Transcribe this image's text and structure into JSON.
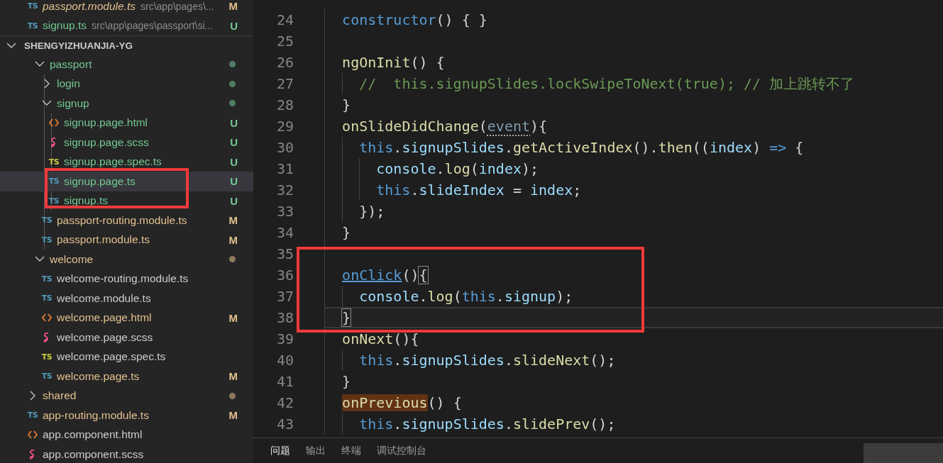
{
  "open_editors": [
    {
      "name": "passport.module.ts",
      "path": "src\\app\\pages\\...",
      "kind": "ts",
      "glyph": "TS",
      "color": "#e2c08d",
      "badge": "M",
      "preview": true
    },
    {
      "name": "signup.ts",
      "path": "src\\app\\pages\\passport\\si...",
      "kind": "ts",
      "glyph": "TS",
      "color": "#73c991",
      "badge": "U",
      "preview": false
    }
  ],
  "explorer": {
    "title": "SHENGYIZHUANJIA-YG",
    "expanded": true,
    "items": [
      {
        "children": [
          {
            "label": "passport",
            "kind": "folder",
            "expanded": true,
            "color": "#73c991",
            "selected": false,
            "children": [
              {
                "label": "login",
                "kind": "folder",
                "expanded": false,
                "color": "#73c991",
                "selected": false
              },
              {
                "label": "signup",
                "kind": "folder",
                "expanded": true,
                "color": "#73c991",
                "selected": false,
                "children": [
                  {
                    "label": "signup.page.html",
                    "kind": "html",
                    "color": "#73c991",
                    "badge": "U",
                    "selected": false
                  },
                  {
                    "label": "signup.page.scss",
                    "kind": "scss",
                    "color": "#73c991",
                    "badge": "U",
                    "selected": false
                  },
                  {
                    "label": "signup.page.spec.ts",
                    "kind": "spec",
                    "glyph": "TS",
                    "color": "#73c991",
                    "badge": "U",
                    "selected": false
                  },
                  {
                    "label": "signup.page.ts",
                    "kind": "ts",
                    "glyph": "TS",
                    "color": "#73c991",
                    "badge": "U",
                    "selected": true
                  },
                  {
                    "label": "signup.ts",
                    "kind": "ts",
                    "glyph": "TS",
                    "color": "#73c991",
                    "badge": "U",
                    "selected": false
                  }
                ]
              },
              {
                "label": "passport-routing.module.ts",
                "kind": "ts",
                "glyph": "TS",
                "color": "#e2c08d",
                "badge": "M",
                "selected": false
              },
              {
                "label": "passport.module.ts",
                "kind": "ts",
                "glyph": "TS",
                "color": "#e2c08d",
                "badge": "M",
                "selected": false
              }
            ]
          },
          {
            "label": "welcome",
            "kind": "folder",
            "expanded": true,
            "color": "#e2c08d",
            "selected": false,
            "children": [
              {
                "label": "welcome-routing.module.ts",
                "kind": "ts",
                "glyph": "TS",
                "selected": false
              },
              {
                "label": "welcome.module.ts",
                "kind": "ts",
                "glyph": "TS",
                "selected": false
              },
              {
                "label": "welcome.page.html",
                "kind": "html",
                "color": "#e2c08d",
                "badge": "M",
                "selected": false
              },
              {
                "label": "welcome.page.scss",
                "kind": "scss",
                "selected": false
              },
              {
                "label": "welcome.page.spec.ts",
                "kind": "spec",
                "glyph": "TS",
                "selected": false
              },
              {
                "label": "welcome.page.ts",
                "kind": "ts",
                "glyph": "TS",
                "color": "#e2c08d",
                "badge": "M",
                "selected": false
              }
            ]
          }
        ]
      },
      {
        "label": "shared",
        "kind": "folder",
        "expanded": false,
        "color": "#e2c08d",
        "selected": false
      },
      {
        "label": "app-routing.module.ts",
        "kind": "ts",
        "glyph": "TS",
        "color": "#e2c08d",
        "badge": "M",
        "selected": false
      },
      {
        "label": "app.component.html",
        "kind": "html",
        "selected": false
      },
      {
        "label": "app.component.scss",
        "kind": "scss",
        "selected": false
      }
    ]
  },
  "editor": {
    "lines": [
      {
        "number": "24",
        "current": false,
        "tokens": [
          {
            "kind": "keyword",
            "text": "  constructor"
          },
          {
            "kind": "plain",
            "text": "() { }"
          }
        ]
      },
      {
        "number": "25",
        "current": false
      },
      {
        "number": "26",
        "current": false,
        "tokens": [
          {
            "kind": "function",
            "text": "  ngOnInit"
          },
          {
            "kind": "plain",
            "text": "() {"
          }
        ]
      },
      {
        "number": "27",
        "current": false,
        "tokens": [
          {
            "kind": "comment",
            "text": "    //  this.signupSlides.lockSwipeToNext(true); // 加上跳转不了"
          }
        ]
      },
      {
        "number": "28",
        "current": false,
        "tokens": [
          {
            "kind": "plain",
            "text": "  }"
          }
        ]
      },
      {
        "number": "29",
        "current": false,
        "tokens": [
          {
            "kind": "function",
            "text": "  onSlideDidChange"
          },
          {
            "kind": "plain",
            "text": "("
          },
          {
            "kind": "unused",
            "text": "event"
          },
          {
            "kind": "plain",
            "text": "){"
          }
        ]
      },
      {
        "number": "30",
        "current": false,
        "tokens": [
          {
            "kind": "keyword",
            "text": "    this"
          },
          {
            "kind": "plain",
            "text": "."
          },
          {
            "kind": "variable",
            "text": "signupSlides"
          },
          {
            "kind": "plain",
            "text": "."
          },
          {
            "kind": "function",
            "text": "getActiveIndex"
          },
          {
            "kind": "plain",
            "text": "()."
          },
          {
            "kind": "function",
            "text": "then"
          },
          {
            "kind": "plain",
            "text": "(("
          },
          {
            "kind": "variable",
            "text": "index"
          },
          {
            "kind": "plain",
            "text": ") "
          },
          {
            "kind": "keyword",
            "text": "=>"
          },
          {
            "kind": "plain",
            "text": " {"
          }
        ]
      },
      {
        "number": "31",
        "current": false,
        "tokens": [
          {
            "kind": "variable",
            "text": "      console"
          },
          {
            "kind": "plain",
            "text": "."
          },
          {
            "kind": "function",
            "text": "log"
          },
          {
            "kind": "plain",
            "text": "("
          },
          {
            "kind": "variable",
            "text": "index"
          },
          {
            "kind": "plain",
            "text": ");"
          }
        ]
      },
      {
        "number": "32",
        "current": false,
        "tokens": [
          {
            "kind": "keyword",
            "text": "      this"
          },
          {
            "kind": "plain",
            "text": "."
          },
          {
            "kind": "variable",
            "text": "slideIndex"
          },
          {
            "kind": "plain",
            "text": " = "
          },
          {
            "kind": "variable",
            "text": "index"
          },
          {
            "kind": "plain",
            "text": ";"
          }
        ]
      },
      {
        "number": "33",
        "current": false,
        "tokens": [
          {
            "kind": "plain",
            "text": "    });"
          }
        ]
      },
      {
        "number": "34",
        "current": false,
        "tokens": [
          {
            "kind": "plain",
            "text": "  }"
          }
        ]
      },
      {
        "number": "35",
        "current": false
      },
      {
        "number": "36",
        "current": false,
        "tokens": [
          {
            "kind": "link",
            "text": "  onClick"
          },
          {
            "kind": "plain",
            "text": "()"
          },
          {
            "kind": "bracket-match",
            "text": "{"
          }
        ]
      },
      {
        "number": "37",
        "current": false,
        "tokens": [
          {
            "kind": "variable",
            "text": "    console"
          },
          {
            "kind": "plain",
            "text": "."
          },
          {
            "kind": "function",
            "text": "log"
          },
          {
            "kind": "plain",
            "text": "("
          },
          {
            "kind": "keyword",
            "text": "this"
          },
          {
            "kind": "plain",
            "text": "."
          },
          {
            "kind": "variable",
            "text": "signup"
          },
          {
            "kind": "plain",
            "text": ");"
          }
        ]
      },
      {
        "number": "38",
        "current": true,
        "tokens": [
          {
            "kind": "bracket-match",
            "text": "  }"
          }
        ]
      },
      {
        "number": "39",
        "current": false,
        "tokens": [
          {
            "kind": "function",
            "text": "  onNext"
          },
          {
            "kind": "plain",
            "text": "(){"
          }
        ]
      },
      {
        "number": "40",
        "current": false,
        "tokens": [
          {
            "kind": "keyword",
            "text": "    this"
          },
          {
            "kind": "plain",
            "text": "."
          },
          {
            "kind": "variable",
            "text": "signupSlides"
          },
          {
            "kind": "plain",
            "text": "."
          },
          {
            "kind": "function",
            "text": "slideNext"
          },
          {
            "kind": "plain",
            "text": "();"
          }
        ]
      },
      {
        "number": "41",
        "current": false,
        "tokens": [
          {
            "kind": "plain",
            "text": "  }"
          }
        ]
      },
      {
        "number": "42",
        "current": false,
        "tokens": [
          {
            "kind": "highlight",
            "text": "  onPrevious"
          },
          {
            "kind": "plain",
            "text": "() {"
          }
        ]
      },
      {
        "number": "43",
        "current": false,
        "tokens": [
          {
            "kind": "keyword",
            "text": "    this"
          },
          {
            "kind": "plain",
            "text": "."
          },
          {
            "kind": "variable",
            "text": "signupSlides"
          },
          {
            "kind": "plain",
            "text": "."
          },
          {
            "kind": "function",
            "text": "slidePrev"
          },
          {
            "kind": "plain",
            "text": "();"
          }
        ]
      }
    ]
  },
  "panel": {
    "tabs": [
      {
        "label": "问题",
        "selected": true
      },
      {
        "label": "输出",
        "selected": false
      },
      {
        "label": "终端",
        "selected": false
      },
      {
        "label": "调试控制台",
        "selected": false
      }
    ]
  }
}
